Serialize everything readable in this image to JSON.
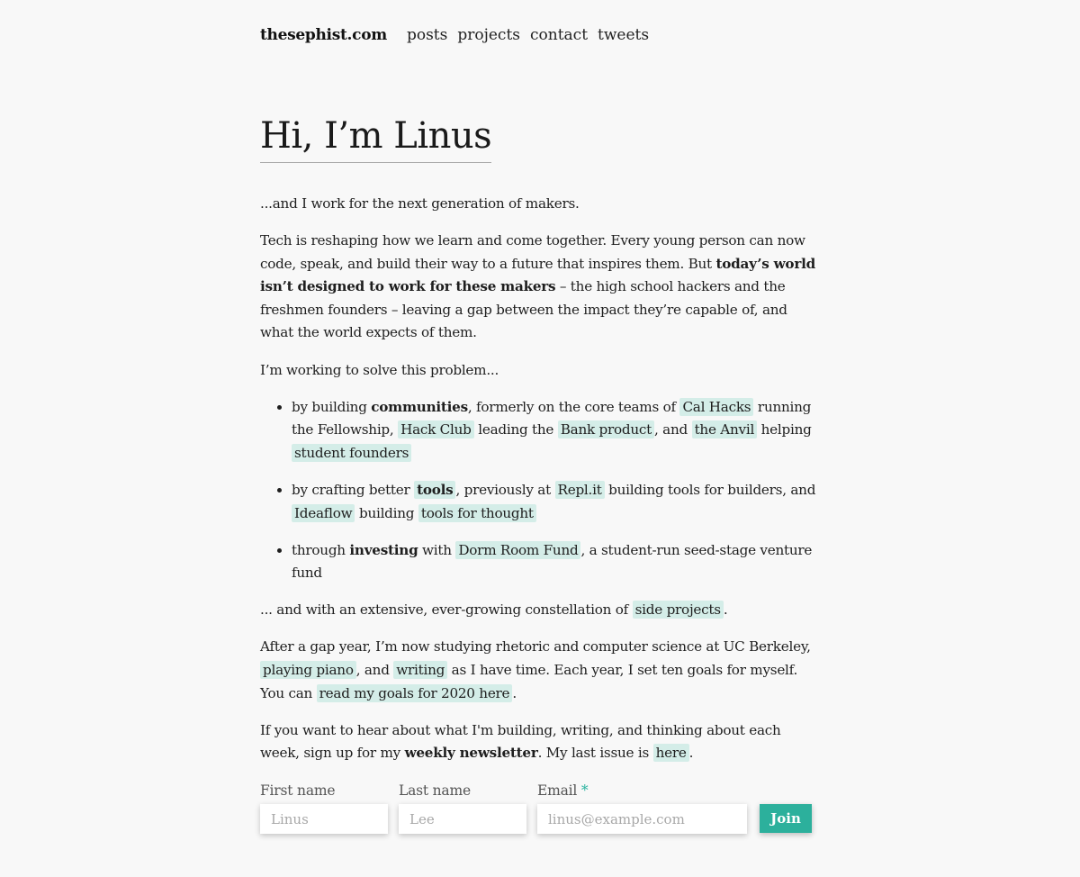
{
  "nav": {
    "brand": "thesephist.com",
    "links": [
      "posts",
      "projects",
      "contact",
      "tweets"
    ]
  },
  "heading": "Hi, I’m Linus",
  "intro": "...and I work for the next generation of makers.",
  "p1": {
    "t1": "Tech is reshaping how we learn and come together. Every young person can now code, speak, and build their way to a future that inspires them. But ",
    "b1": "today’s world isn’t designed to work for these makers",
    "t2": " – the high school hackers and the freshmen founders – leaving a gap between the impact they’re capable of, and what the world expects of them."
  },
  "p2": "I’m working to solve this problem...",
  "list": {
    "item1": {
      "t1": "by building ",
      "b1": "communities",
      "t2": ", formerly on the core teams of ",
      "l1": "Cal Hacks",
      "t3": " running the Fellowship, ",
      "l2": "Hack Club",
      "t4": " leading the ",
      "l3": "Bank product",
      "t5": ", and ",
      "l4": "the Anvil",
      "t6": " helping ",
      "l5": "student founders"
    },
    "item2": {
      "t1": "by crafting better ",
      "l1": "tools",
      "t2": ", previously at ",
      "l2": "Repl.it",
      "t3": " building tools for builders, and ",
      "l3": "Ideaflow",
      "t4": " building ",
      "l4": "tools for thought"
    },
    "item3": {
      "t1": "through ",
      "b1": "investing",
      "t2": " with ",
      "l1": "Dorm Room Fund",
      "t3": ", a student-run seed-stage venture fund"
    }
  },
  "p3": {
    "t1": "... and with an extensive, ever-growing constellation of ",
    "l1": "side projects",
    "t2": "."
  },
  "p4": {
    "t1": "After a gap year, I’m now studying rhetoric and computer science at UC Berkeley, ",
    "l1": "playing piano",
    "t2": ", and ",
    "l2": "writing",
    "t3": " as I have time. Each year, I set ten goals for myself. You can ",
    "l3": "read my goals for 2020 here",
    "t4": "."
  },
  "p5": {
    "t1": "If you want to hear about what I'm building, writing, and thinking about each week, sign up for my ",
    "b1": "weekly newsletter",
    "t2": ". My last issue is ",
    "l1": "here",
    "t3": "."
  },
  "form": {
    "first_label": "First name",
    "first_placeholder": "Linus",
    "last_label": "Last name",
    "last_placeholder": "Lee",
    "email_label": "Email",
    "email_required": "*",
    "email_placeholder": "linus@example.com",
    "join_label": "Join"
  },
  "colors": {
    "highlight": "#d4ede8",
    "accent": "#2cb09c"
  }
}
